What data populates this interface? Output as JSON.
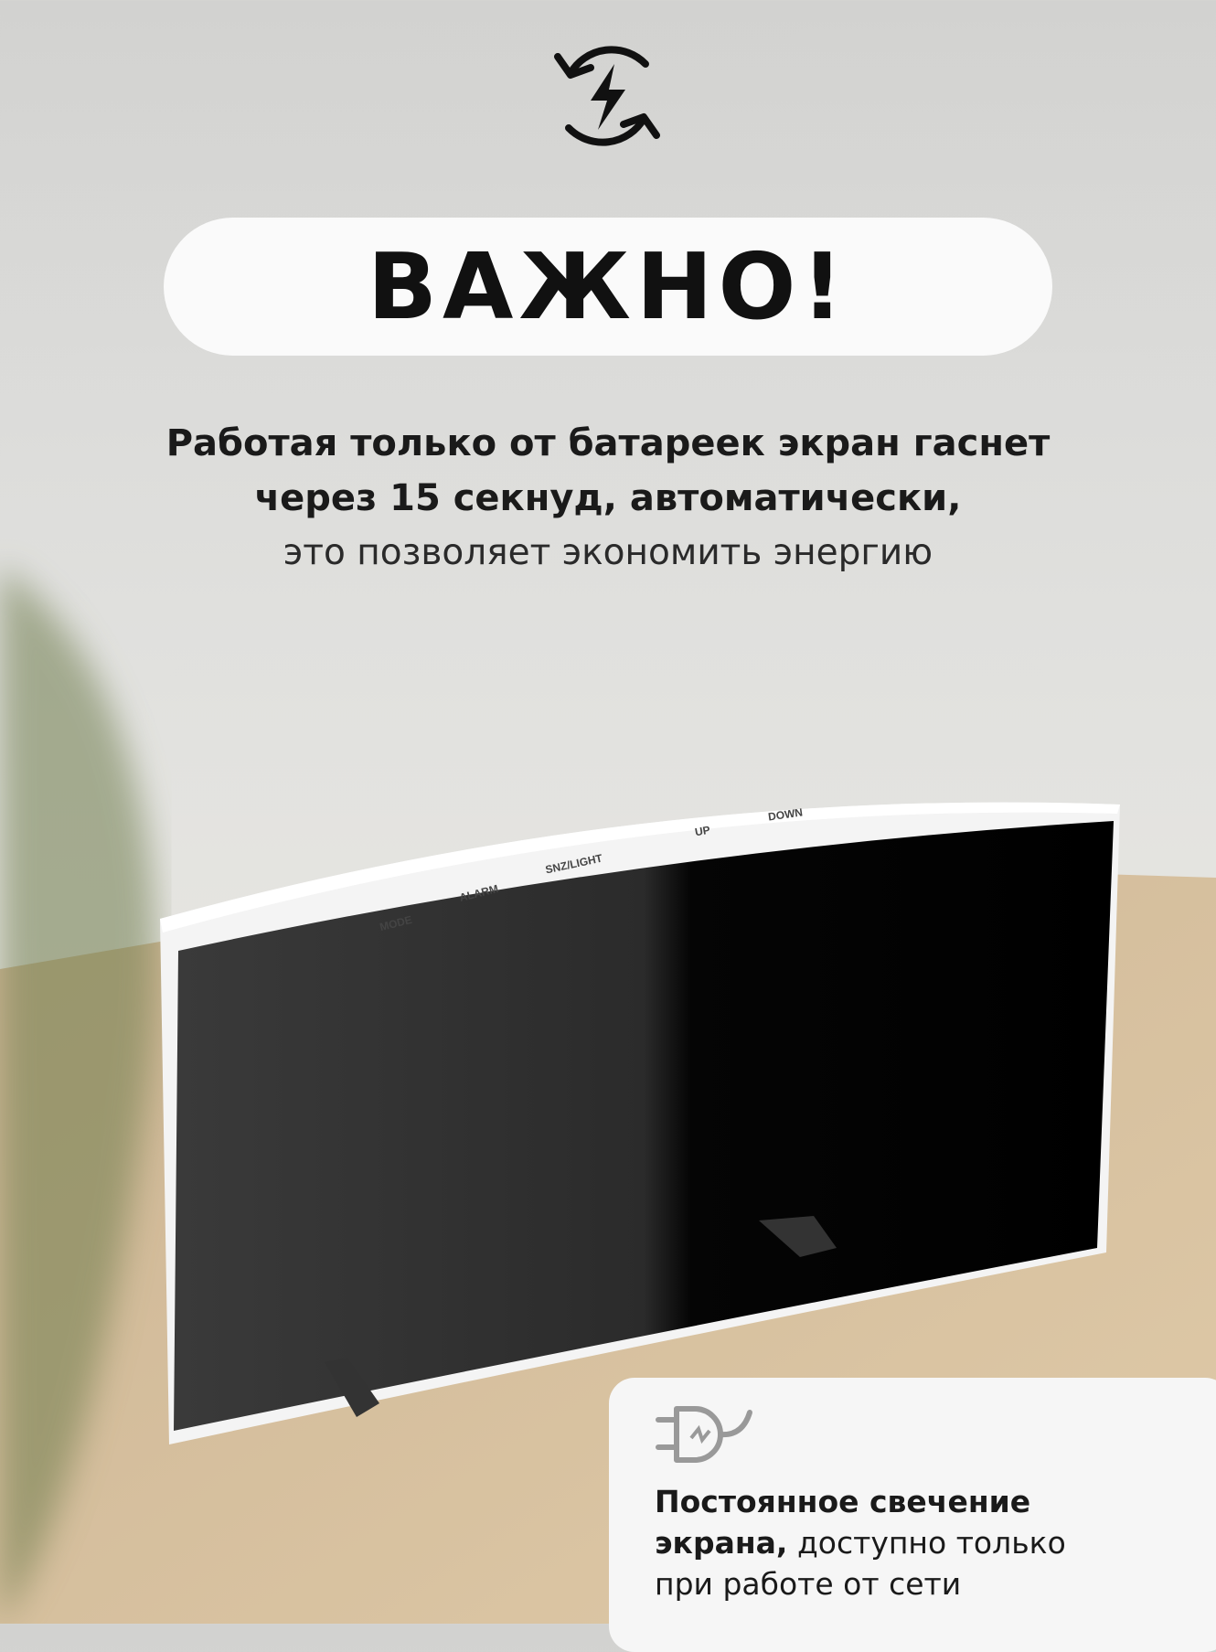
{
  "icon": "energy-saving-cycle-icon",
  "headline": "ВАЖНО!",
  "description": {
    "line1": "Работая только от батареек экран гаснет",
    "line2": "через 15 секнуд, автоматически,",
    "line3": "это позволяет экономить энергию"
  },
  "clock_buttons": [
    "MODE",
    "ALARM",
    "SNZ/LIGHT",
    "UP",
    "DOWN"
  ],
  "note": {
    "icon": "plug-icon",
    "bold_line1": "Постоянное свечение",
    "bold_line2": "экрана,",
    "rest_line2": " доступно только",
    "line3": "при работе от сети"
  }
}
